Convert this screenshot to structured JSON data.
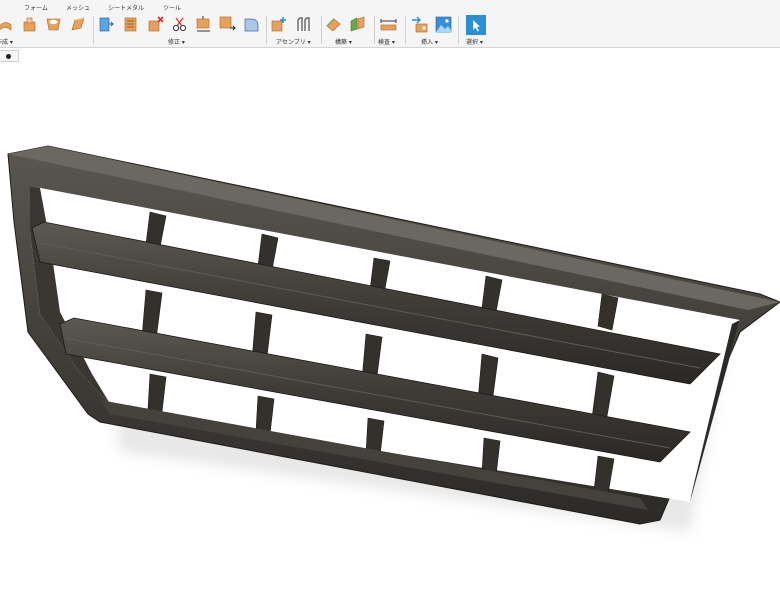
{
  "toolbar": {
    "tabs": [
      "フォーム",
      "メッシュ",
      "シートメタル",
      "ツール"
    ],
    "groups": {
      "create": "作成 ▾",
      "modify": "修正 ▾",
      "assemble": "アセンブリ ▾",
      "construct": "構築 ▾",
      "inspect": "検査 ▾",
      "insert": "挿入 ▾",
      "select": "選択 ▾"
    }
  },
  "colors": {
    "accent_orange": "#e8a15a",
    "accent_blue": "#2c8fd6",
    "model_dark": "#3d3a36"
  },
  "icons": [
    "extrude-icon",
    "revolve-icon",
    "sweep-icon",
    "loft-icon",
    "press-pull-icon",
    "shell-icon",
    "delete-face-icon",
    "split-icon",
    "scale-icon",
    "move-icon",
    "fillet-icon",
    "new-component-icon",
    "joint-icon",
    "offset-plane-icon",
    "axis-icon",
    "measure-icon",
    "insert-mcmaster-icon",
    "insert-image-icon",
    "select-cursor-icon"
  ]
}
